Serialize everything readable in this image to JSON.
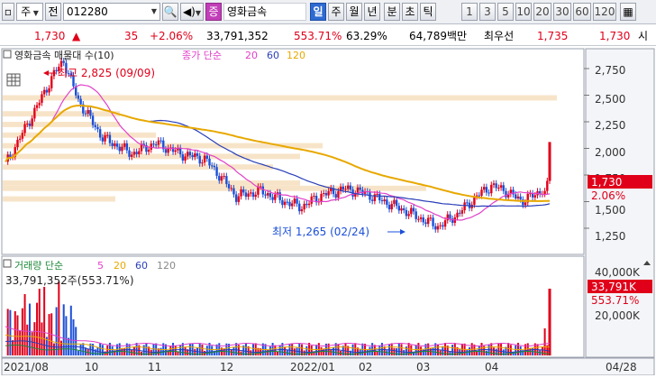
{
  "toolbar": {
    "market_code": "주",
    "tab_jeon": "전",
    "stock_code": "012280",
    "stock_name_tag": "증",
    "stock_name": "영화금속",
    "periods": [
      "일",
      "주",
      "월",
      "년",
      "분",
      "초",
      "틱"
    ],
    "active_period": "일",
    "numbers": [
      "1",
      "3",
      "5",
      "10",
      "20",
      "30",
      "60",
      "120"
    ]
  },
  "quote": {
    "price": "1,730",
    "change_arrow": "▲",
    "change": "35",
    "change_pct": "+2.06%",
    "volume": "33,791,352",
    "volume_ratio": "553.71%",
    "turnover": "63.29%",
    "amount": "64,789백만",
    "best_label": "최우선",
    "best_ask": "1,735",
    "best_bid": "1,730",
    "trailing": "시"
  },
  "price_panel": {
    "title": "영화금속 매물대 수(10)",
    "legend_prefix": "종가 단순",
    "ma_labels": [
      "20",
      "60",
      "120"
    ],
    "max_label": "최고 2,825 (09/09)",
    "min_label": "최저 1,265 (02/24)",
    "y_ticks": [
      "2,750",
      "2,500",
      "2,250",
      "2,000",
      "1,750",
      "1,500",
      "1,250"
    ],
    "current_price_tag": "1,730",
    "current_pct_tag": "2.06%"
  },
  "volume_panel": {
    "legend_prefix": "거래량 단순",
    "ma_labels": [
      "5",
      "20",
      "60",
      "120"
    ],
    "value_label": "33,791,352주(553.71%)",
    "y_ticks": [
      "40,000K",
      "20,000K"
    ],
    "current_tag": "33,791K",
    "current_pct_tag": "553.71%"
  },
  "x_axis": {
    "labels": [
      "2021/08",
      "10",
      "11",
      "12",
      "2022/01",
      "02",
      "03",
      "04",
      "04/28"
    ]
  },
  "colors": {
    "up": "#e0001a",
    "down": "#1b4fd8",
    "ma20": "#e040c8",
    "ma60": "#2a3fb8",
    "ma120": "#e8a800",
    "profile": "#f7e4c8"
  }
}
